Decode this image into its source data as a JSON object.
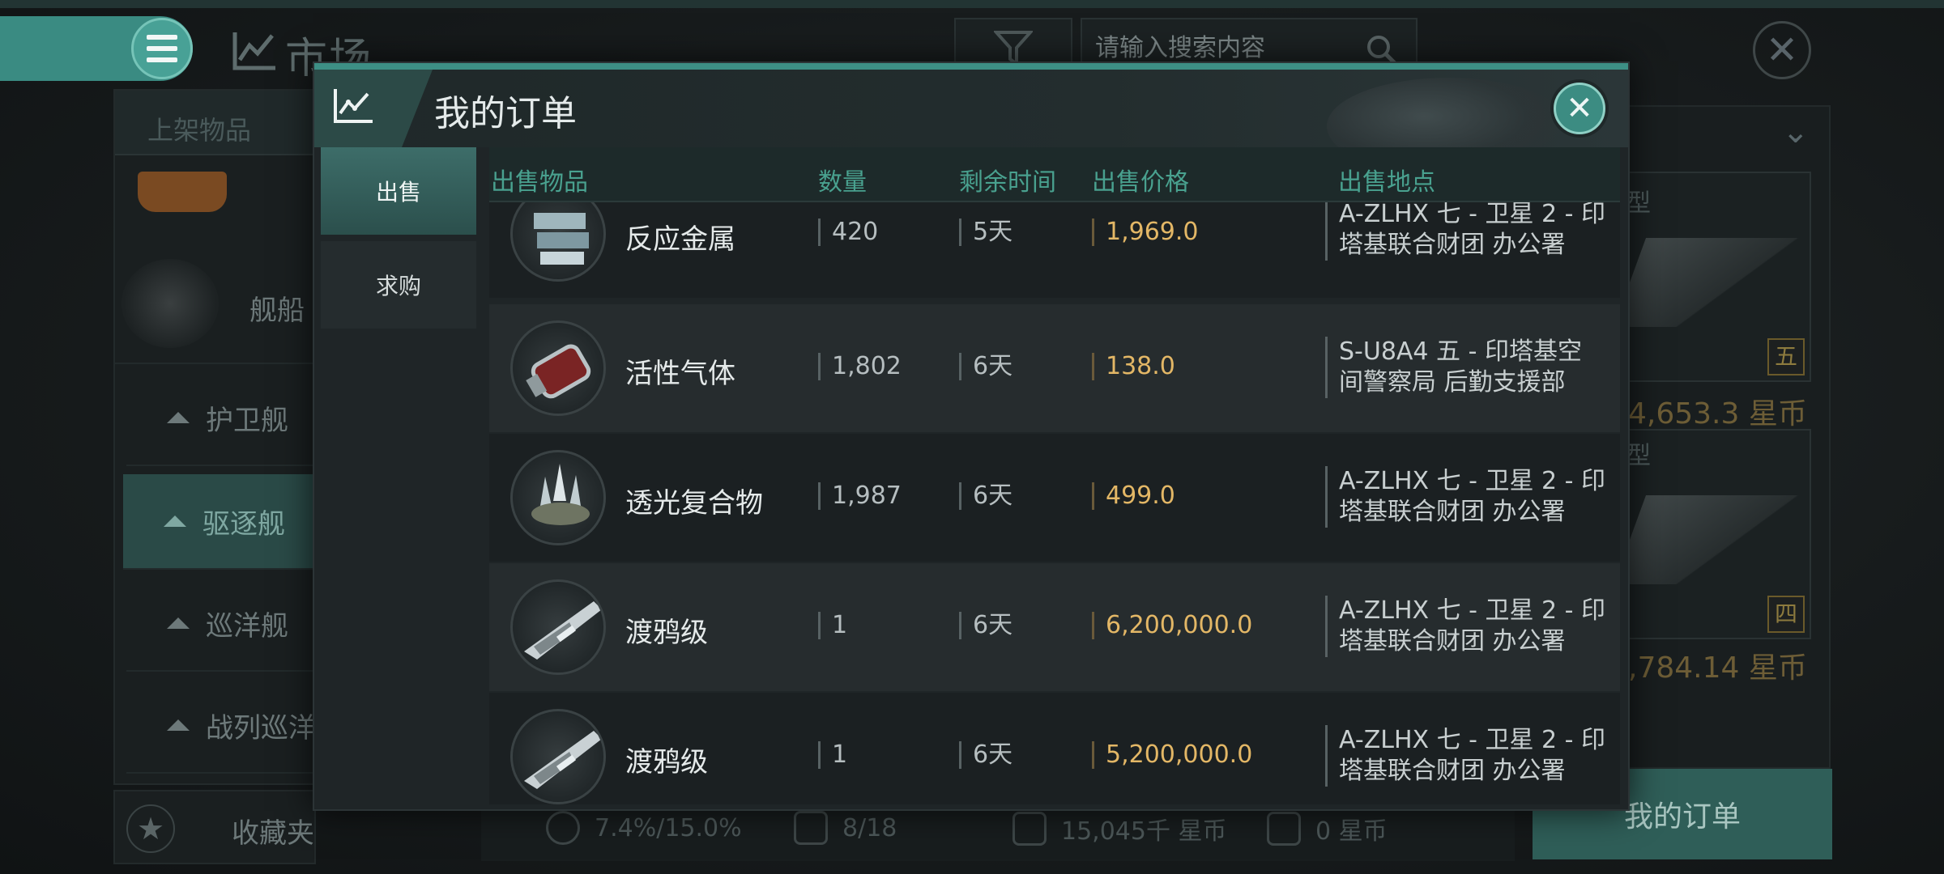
{
  "market": {
    "title": "市场",
    "search_placeholder": "请输入搜索内容",
    "left_panel": {
      "header": "上架物品",
      "ships_label": "舰船",
      "categories": [
        "护卫舰",
        "驱逐舰",
        "巡洋舰",
        "战列巡洋"
      ],
      "favorites": "收藏夹"
    },
    "right_panel": {
      "type_label_1": "型",
      "type_label_2": "型",
      "tier_1": "五",
      "tier_2": "四",
      "price_1": "4,653.3 星币",
      "price_2": ",784.14 星币",
      "my_orders_button": "我的订单"
    },
    "bottom_stats": {
      "tax": "7.4%/15.0%",
      "orders": "8/18",
      "balance": "15,045千 星币",
      "escrow": "0 星币"
    }
  },
  "modal": {
    "title": "我的订单",
    "tabs": [
      "出售",
      "求购"
    ],
    "columns": {
      "item": "出售物品",
      "quantity": "数量",
      "time_left": "剩余时间",
      "price": "出售价格",
      "location": "出售地点"
    },
    "orders": [
      {
        "name": "反应金属",
        "quantity": "420",
        "time_left": "5天",
        "price": "1,969.0",
        "location_line1": "A-ZLHX 七 - 卫星 2 - 印",
        "location_line2": "塔基联合财团 办公署",
        "icon": "metal-ingots-icon"
      },
      {
        "name": "活性气体",
        "quantity": "1,802",
        "time_left": "6天",
        "price": "138.0",
        "location_line1": "S-U8A4 五 - 印塔基空",
        "location_line2": "间警察局 后勤支援部",
        "icon": "gas-canister-icon"
      },
      {
        "name": "透光复合物",
        "quantity": "1,987",
        "time_left": "6天",
        "price": "499.0",
        "location_line1": "A-ZLHX 七 - 卫星 2 - 印",
        "location_line2": "塔基联合财团 办公署",
        "icon": "crystal-icon"
      },
      {
        "name": "渡鸦级",
        "quantity": "1",
        "time_left": "6天",
        "price": "6,200,000.0",
        "location_line1": "A-ZLHX 七 - 卫星 2 - 印",
        "location_line2": "塔基联合财团 办公署",
        "icon": "ship-icon"
      },
      {
        "name": "渡鸦级",
        "quantity": "1",
        "time_left": "6天",
        "price": "5,200,000.0",
        "location_line1": "A-ZLHX 七 - 卫星 2 - 印",
        "location_line2": "塔基联合财团 办公署",
        "icon": "ship-icon"
      }
    ]
  },
  "colors": {
    "accent": "#3d8f85",
    "header_text": "#49a18f",
    "price_text": "#e3b766"
  }
}
